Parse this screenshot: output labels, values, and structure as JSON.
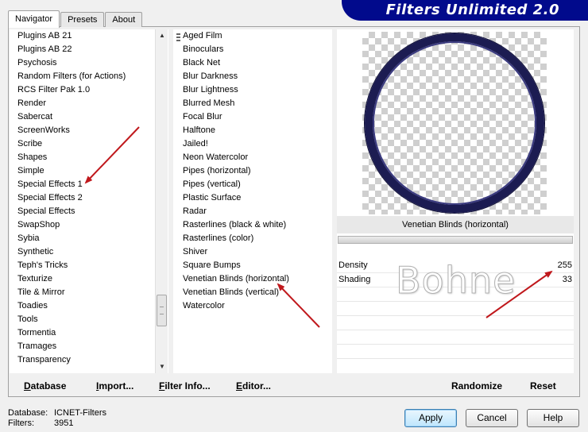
{
  "tabs": [
    {
      "label": "Navigator",
      "active": true
    },
    {
      "label": "Presets",
      "active": false
    },
    {
      "label": "About",
      "active": false
    }
  ],
  "banner_title": "Filters Unlimited 2.0",
  "categories": [
    "Plugins AB 21",
    "Plugins AB 22",
    "Psychosis",
    "Random Filters (for Actions)",
    "RCS Filter Pak 1.0",
    "Render",
    "Sabercat",
    "ScreenWorks",
    "Scribe",
    "Shapes",
    "Simple",
    "Special Effects 1",
    "Special Effects 2",
    "Special Effects",
    "SwapShop",
    "Sybia",
    "Synthetic",
    "Teph's Tricks",
    "Texturize",
    "Tile & Mirror",
    "Toadies",
    "Tools",
    "Tormentia",
    "Tramages",
    "Transparency"
  ],
  "filters": [
    "Aged Film",
    "Binoculars",
    "Black Net",
    "Blur Darkness",
    "Blur Lightness",
    "Blurred Mesh",
    "Focal Blur",
    "Halftone",
    "Jailed!",
    "Neon Watercolor",
    "Pipes (horizontal)",
    "Pipes (vertical)",
    "Plastic Surface",
    "Radar",
    "Rasterlines (black & white)",
    "Rasterlines (color)",
    "Shiver",
    "Square Bumps",
    "Venetian Blinds (horizontal)",
    "Venetian Blinds (vertical)",
    "Watercolor"
  ],
  "selected_filter": "Venetian Blinds (horizontal)",
  "params": [
    {
      "label": "Density",
      "value": "255"
    },
    {
      "label": "Shading",
      "value": "33"
    }
  ],
  "watermark": "Bohne",
  "bottom_links": {
    "database": "Database",
    "import": "Import...",
    "filter_info": "Filter Info...",
    "editor": "Editor...",
    "randomize": "Randomize",
    "reset": "Reset"
  },
  "status": {
    "database_label": "Database:",
    "database_value": "ICNET-Filters",
    "filters_label": "Filters:",
    "filters_value": "3951"
  },
  "buttons": {
    "apply": "Apply",
    "cancel": "Cancel",
    "help": "Help"
  },
  "colors": {
    "banner": "#010a8c",
    "arrow": "#c0181c",
    "ring": "#1c1c52"
  }
}
